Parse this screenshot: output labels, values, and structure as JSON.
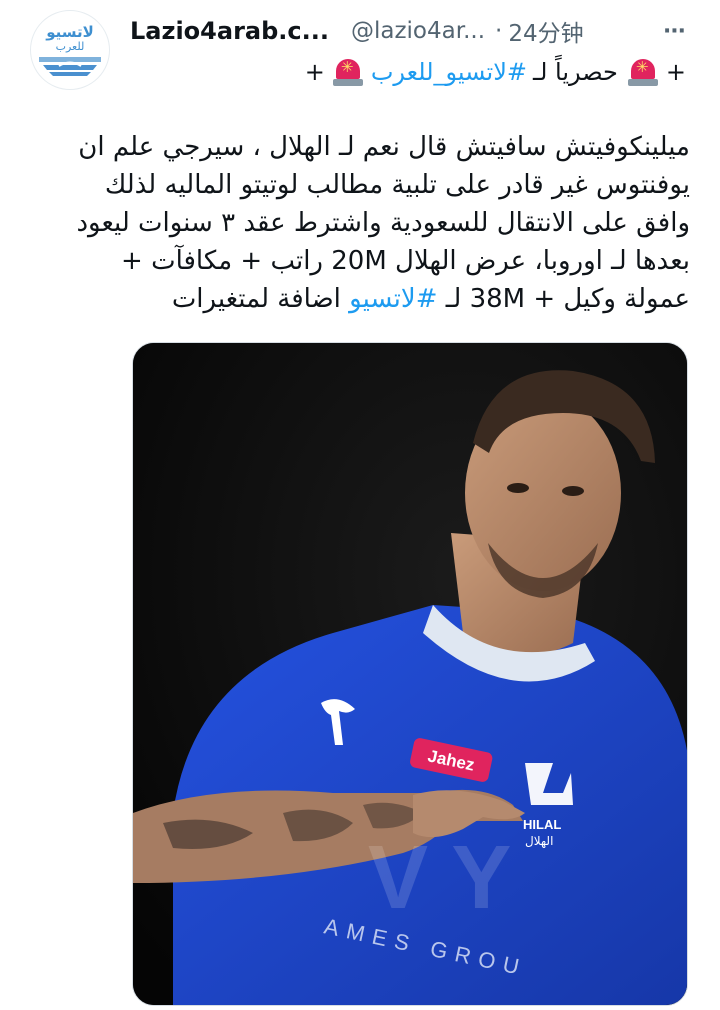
{
  "author": {
    "avatar_logo_text": "لاتسيو",
    "avatar_logo_sub": "للعرب",
    "display_name": "Lazio4arab.c...",
    "handle": "@lazio4ar...",
    "separator": "·",
    "timestamp": "24分钟"
  },
  "headline": {
    "prefix": "+",
    "text": "حصرياً لـ",
    "hashtag": "#لاتسيو_للعرب",
    "suffix": "+"
  },
  "body": {
    "line1": "ميلينكوفيتش سافيتش قال نعم لـ الهلال ، سيرجي علم ان",
    "line2": "يوفنتوس غير قادر على تلبية مطالب لوتيتو الماليه لذلك",
    "line3": "وافق على الانتقال للسعودية واشترط عقد ٣ سنوات ليعود",
    "line4": "بعدها لـ اوروبا، عرض الهلال 20M راتب + مكافآت +",
    "line5_start": "عمولة وكيل + 38M لـ ",
    "line5_hashtag": "#لاتسيو",
    "line5_end": " اضافة لمتغيرات"
  },
  "media": {
    "sponsor_label": "Jahez",
    "club_text": "HILAL",
    "club_arabic": "الهلال",
    "shirt_text": "AMES GROU"
  },
  "colors": {
    "link": "#1d9bf0",
    "secondary_text": "#536471",
    "shirt_blue": "#1c44c9"
  }
}
